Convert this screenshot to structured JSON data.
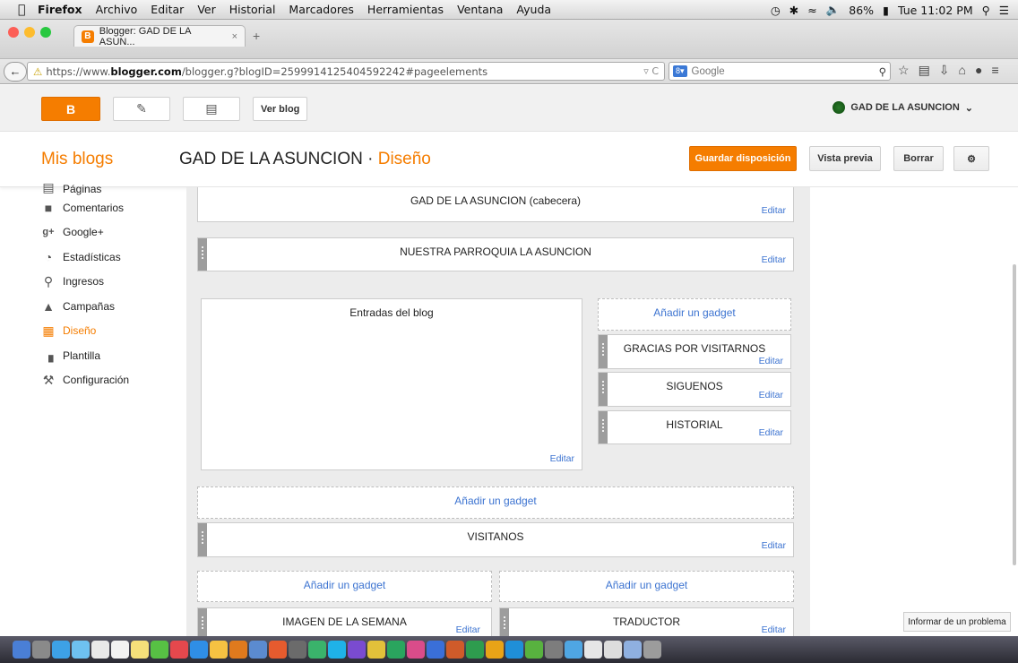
{
  "menubar": {
    "app": "Firefox",
    "items": [
      "Archivo",
      "Editar",
      "Ver",
      "Historial",
      "Marcadores",
      "Herramientas",
      "Ventana",
      "Ayuda"
    ],
    "battery": "86%",
    "clock": "Tue 11:02 PM"
  },
  "browser": {
    "tab_title": "Blogger: GAD DE LA ASUN...",
    "url_prefix": "https://www.",
    "url_host": "blogger.com",
    "url_path": "/blogger.g?blogID=2599914125404592242#pageelements",
    "search_placeholder": "Google"
  },
  "blogger": {
    "view_blog": "Ver blog",
    "account": "GAD DE LA ASUNCION"
  },
  "header": {
    "my_blogs": "Mis blogs",
    "blog_name": "GAD DE LA ASUNCION",
    "separator": "·",
    "section": "Diseño",
    "save": "Guardar disposición",
    "preview": "Vista previa",
    "delete": "Borrar"
  },
  "sidebar": {
    "items": [
      {
        "label": "Páginas",
        "icon": "pages-icon"
      },
      {
        "label": "Comentarios",
        "icon": "comment-icon"
      },
      {
        "label": "Google+",
        "icon": "google-plus-icon"
      },
      {
        "label": "Estadísticas",
        "icon": "pie-chart-icon"
      },
      {
        "label": "Ingresos",
        "icon": "trophy-icon"
      },
      {
        "label": "Campañas",
        "icon": "campaign-icon"
      },
      {
        "label": "Diseño",
        "icon": "layout-icon"
      },
      {
        "label": "Plantilla",
        "icon": "paint-roller-icon"
      },
      {
        "label": "Configuración",
        "icon": "wrench-icon"
      }
    ]
  },
  "layout": {
    "edit": "Editar",
    "add_gadget": "Añadir un gadget",
    "header_gadget": "GAD DE LA ASUNCION (cabecera)",
    "parroquia": "NUESTRA PARROQUIA LA ASUNCION",
    "posts": "Entradas del blog",
    "gracias": "GRACIAS POR VISITARNOS",
    "siguenos": "SIGUENOS",
    "historial": "HISTORIAL",
    "visitanos": "VISITANOS",
    "imagen": "IMAGEN DE LA SEMANA",
    "traductor": "TRADUCTOR"
  },
  "report_problem": "Informar de un problema",
  "colors": {
    "accent": "#f57d00",
    "link": "#3d74d1"
  }
}
